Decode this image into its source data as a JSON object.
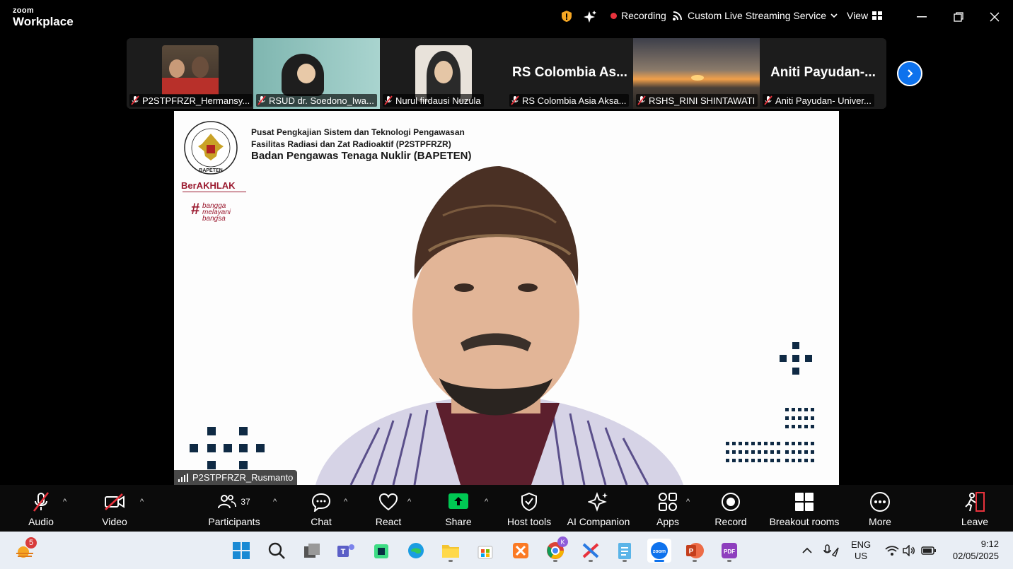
{
  "app": {
    "brand_small": "zoom",
    "brand_big": "Workplace"
  },
  "titlebar": {
    "recording_label": "Recording",
    "streaming_label": "Custom Live Streaming Service",
    "view_label": "View"
  },
  "participants_strip": [
    {
      "name": "P2STPFRZR_Hermansy..."
    },
    {
      "name": "RSUD dr. Soedono_Iwa..."
    },
    {
      "name": "Nurul firdausi Nuzula"
    },
    {
      "name": "RS Colombia Asia Aksa...",
      "display": "RS Colombia As..."
    },
    {
      "name": "RSHS_RINI SHINTAWATI"
    },
    {
      "name": "Aniti Payudan- Univer...",
      "display": "Aniti Payudan-..."
    }
  ],
  "slide": {
    "header_line1": "Pusat Pengkajian Sistem dan Teknologi Pengawasan",
    "header_line2": "Fasilitas Radiasi dan Zat Radioaktif (P2STPFRZR)",
    "header_line3": "Badan Pengawas Tenaga Nuklir (BAPETEN)",
    "seal_text": "BAPETEN",
    "berakhlak": "BerAKHLAK",
    "bangga_1": "bangga",
    "bangga_2": "melayani",
    "bangga_3": "bangsa"
  },
  "speaker": {
    "name": "P2STPFRZR_Rusmanto"
  },
  "toolbar": {
    "audio": "Audio",
    "video": "Video",
    "participants": "Participants",
    "participants_count": "37",
    "chat": "Chat",
    "react": "React",
    "share": "Share",
    "host_tools": "Host tools",
    "ai_companion": "AI Companion",
    "apps": "Apps",
    "record": "Record",
    "breakout_rooms": "Breakout rooms",
    "more": "More",
    "leave": "Leave"
  },
  "taskbar": {
    "weather_badge": "5",
    "chrome_badge": "K",
    "lang_1": "ENG",
    "lang_2": "US",
    "time": "9:12",
    "date": "02/05/2025"
  },
  "colors": {
    "accent": "#0e72ed",
    "recording": "#e8323c",
    "share_green": "#00c853",
    "mute_red": "#e8323c"
  }
}
